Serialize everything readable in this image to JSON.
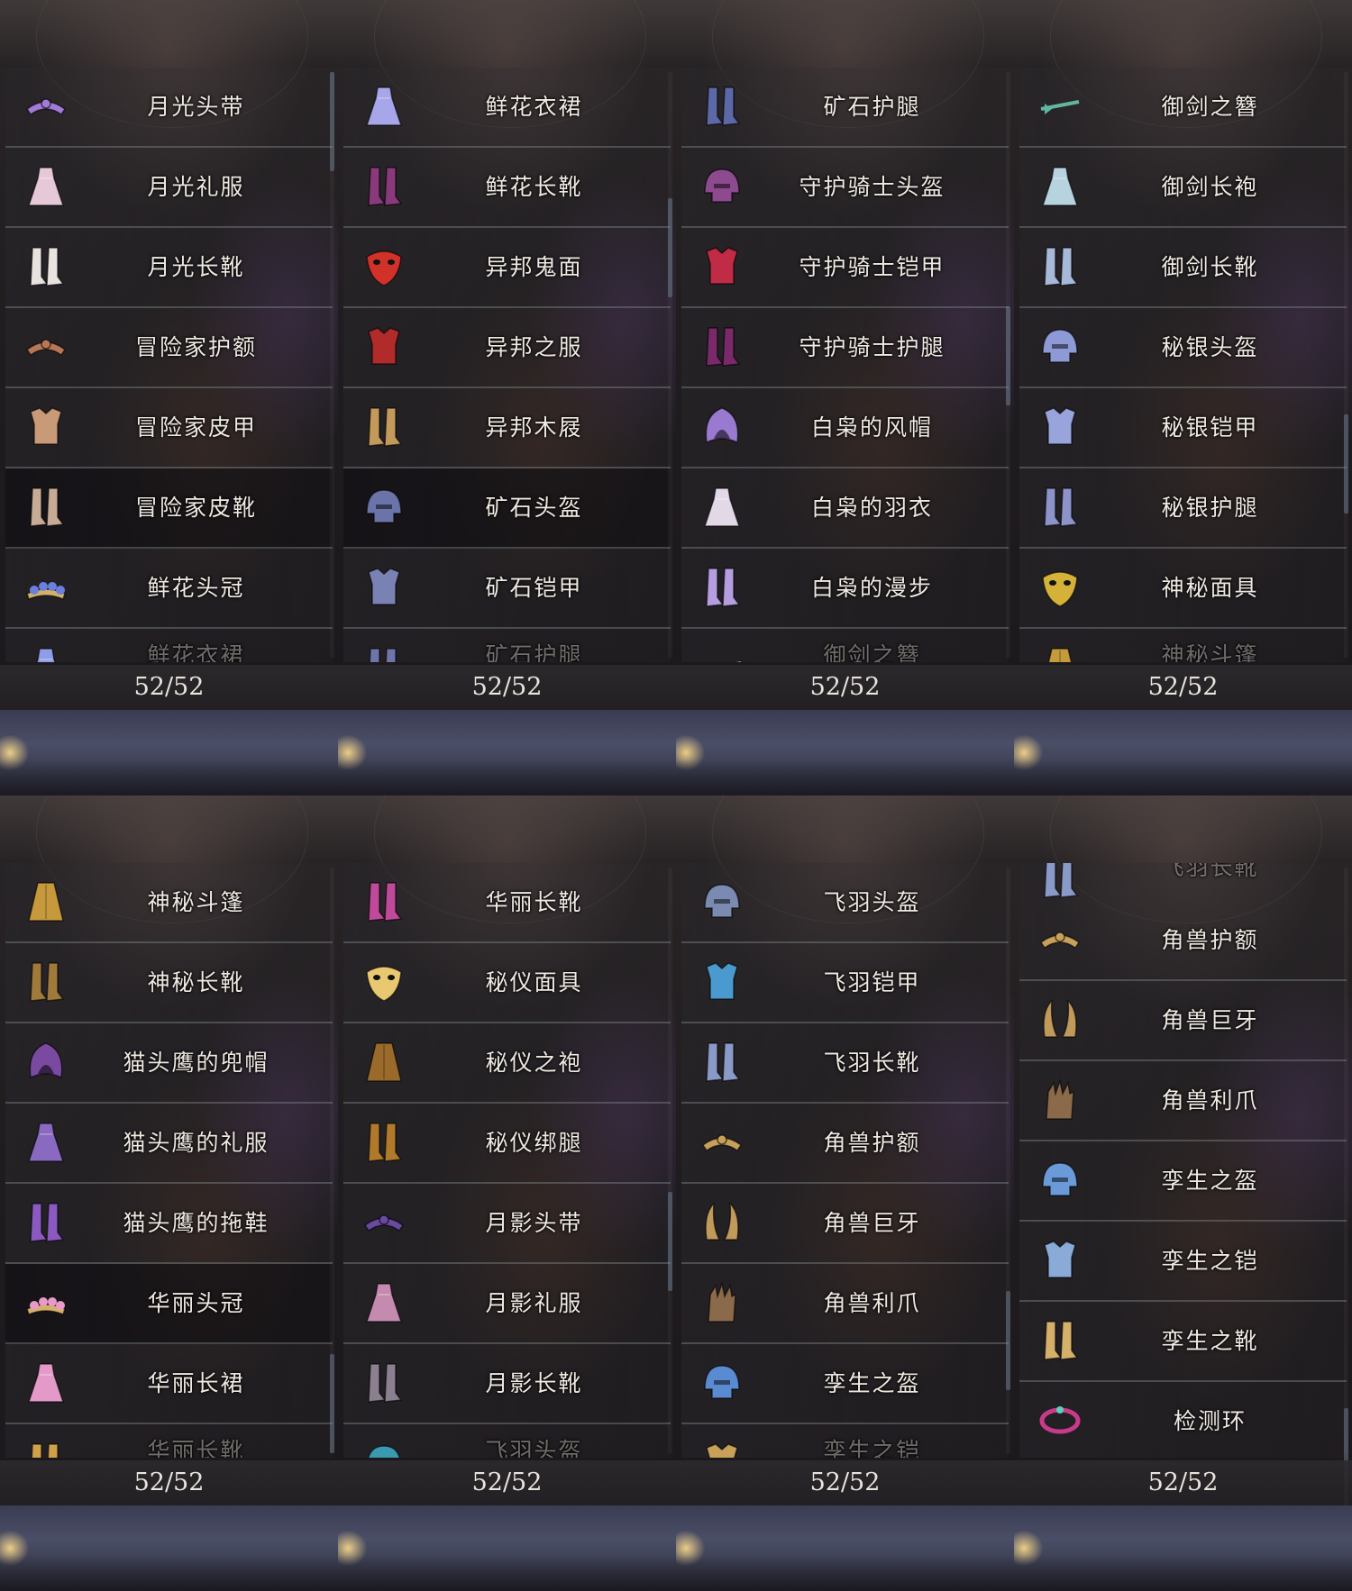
{
  "panels": [
    {
      "count": "52/52",
      "items": [
        {
          "name": "月光头带",
          "icon": "headband-icon",
          "color": "#a27bd6"
        },
        {
          "name": "月光礼服",
          "icon": "dress-icon",
          "color": "#e6c9d8"
        },
        {
          "name": "月光长靴",
          "icon": "boots-icon",
          "color": "#e9e3e0"
        },
        {
          "name": "冒险家护额",
          "icon": "headband-icon",
          "color": "#b87858"
        },
        {
          "name": "冒险家皮甲",
          "icon": "armor-icon",
          "color": "#c99a77"
        },
        {
          "name": "冒险家皮靴",
          "icon": "boots-icon",
          "color": "#c7ab95"
        },
        {
          "name": "鲜花头冠",
          "icon": "crown-icon",
          "color": "#6b7fe0"
        },
        {
          "name": "鲜花衣裙",
          "icon": "dress-icon",
          "color": "#8f9ce6",
          "partial": true
        }
      ]
    },
    {
      "count": "52/52",
      "items": [
        {
          "name": "鲜花衣裙",
          "icon": "dress-icon",
          "color": "#a7a6e8"
        },
        {
          "name": "鲜花长靴",
          "icon": "boots-icon",
          "color": "#8a3a7a"
        },
        {
          "name": "异邦鬼面",
          "icon": "mask-icon",
          "color": "#d0322a"
        },
        {
          "name": "异邦之服",
          "icon": "armor-icon",
          "color": "#b22b2b"
        },
        {
          "name": "异邦木屐",
          "icon": "boots-icon",
          "color": "#c49a5a"
        },
        {
          "name": "矿石头盔",
          "icon": "helmet-icon",
          "color": "#6a74a8"
        },
        {
          "name": "矿石铠甲",
          "icon": "armor-icon",
          "color": "#7a82b4"
        },
        {
          "name": "矿石护腿",
          "icon": "boots-icon",
          "color": "#6d76aa",
          "partial": true
        }
      ]
    },
    {
      "count": "52/52",
      "items": [
        {
          "name": "矿石护腿",
          "icon": "boots-icon",
          "color": "#5d68a6"
        },
        {
          "name": "守护骑士头盔",
          "icon": "helmet-icon",
          "color": "#8d4a8f"
        },
        {
          "name": "守护骑士铠甲",
          "icon": "armor-icon",
          "color": "#c02b45"
        },
        {
          "name": "守护骑士护腿",
          "icon": "boots-icon",
          "color": "#7a2a6a"
        },
        {
          "name": "白枭的风帽",
          "icon": "hood-icon",
          "color": "#9a7ad0"
        },
        {
          "name": "白枭的羽衣",
          "icon": "dress-icon",
          "color": "#e2d8e6"
        },
        {
          "name": "白枭的漫步",
          "icon": "boots-icon",
          "color": "#b59ee0"
        },
        {
          "name": "御剑之簪",
          "icon": "hairpin-icon",
          "color": "#9aa6c0",
          "partial": true
        }
      ]
    },
    {
      "count": "52/52",
      "items": [
        {
          "name": "御剑之簪",
          "icon": "hairpin-icon",
          "color": "#5fb7a0"
        },
        {
          "name": "御剑长袍",
          "icon": "dress-icon",
          "color": "#b7d3e0"
        },
        {
          "name": "御剑长靴",
          "icon": "boots-icon",
          "color": "#a7b8d8"
        },
        {
          "name": "秘银头盔",
          "icon": "helmet-icon",
          "color": "#8e9ad6"
        },
        {
          "name": "秘银铠甲",
          "icon": "armor-icon",
          "color": "#9aa4dc"
        },
        {
          "name": "秘银护腿",
          "icon": "boots-icon",
          "color": "#8b93c8"
        },
        {
          "name": "神秘面具",
          "icon": "mask-icon",
          "color": "#d4b23a"
        },
        {
          "name": "神秘斗篷",
          "icon": "cloak-icon",
          "color": "#c49a3a",
          "partial": true
        }
      ]
    },
    {
      "count": "52/52",
      "items": [
        {
          "name": "神秘斗篷",
          "icon": "cloak-icon",
          "color": "#c69a3c"
        },
        {
          "name": "神秘长靴",
          "icon": "boots-icon",
          "color": "#a07a3a"
        },
        {
          "name": "猫头鹰的兜帽",
          "icon": "hood-icon",
          "color": "#7a4aa0"
        },
        {
          "name": "猫头鹰的礼服",
          "icon": "dress-icon",
          "color": "#8a6ac0"
        },
        {
          "name": "猫头鹰的拖鞋",
          "icon": "boots-icon",
          "color": "#8a5ac0"
        },
        {
          "name": "华丽头冠",
          "icon": "crown-icon",
          "color": "#ea9ac8"
        },
        {
          "name": "华丽长裙",
          "icon": "dress-icon",
          "color": "#e49ac8"
        },
        {
          "name": "华丽长靴",
          "icon": "boots-icon",
          "color": "#d0a04a",
          "partial": true
        }
      ]
    },
    {
      "count": "52/52",
      "items": [
        {
          "name": "华丽长靴",
          "icon": "boots-icon",
          "color": "#c04a9a"
        },
        {
          "name": "秘仪面具",
          "icon": "mask-icon",
          "color": "#e8c870"
        },
        {
          "name": "秘仪之袍",
          "icon": "cloak-icon",
          "color": "#9a6a2a"
        },
        {
          "name": "秘仪绑腿",
          "icon": "boots-icon",
          "color": "#b07a2a"
        },
        {
          "name": "月影头带",
          "icon": "headband-icon",
          "color": "#6a4aa0"
        },
        {
          "name": "月影礼服",
          "icon": "dress-icon",
          "color": "#c48ab0"
        },
        {
          "name": "月影长靴",
          "icon": "boots-icon",
          "color": "#8a8090"
        },
        {
          "name": "飞羽头盔",
          "icon": "helmet-icon",
          "color": "#3a9ab0",
          "partial": true
        }
      ]
    },
    {
      "count": "52/52",
      "items": [
        {
          "name": "飞羽头盔",
          "icon": "helmet-icon",
          "color": "#7a8ab0"
        },
        {
          "name": "飞羽铠甲",
          "icon": "armor-icon",
          "color": "#4a9ad0"
        },
        {
          "name": "飞羽长靴",
          "icon": "boots-icon",
          "color": "#8a9ac8"
        },
        {
          "name": "角兽护额",
          "icon": "headband-icon",
          "color": "#c8a05a"
        },
        {
          "name": "角兽巨牙",
          "icon": "horn-icon",
          "color": "#c09a5a"
        },
        {
          "name": "角兽利爪",
          "icon": "claw-icon",
          "color": "#8a6a4a"
        },
        {
          "name": "孪生之盔",
          "icon": "helmet-icon",
          "color": "#5a8ad0"
        },
        {
          "name": "孪生之铠",
          "icon": "armor-icon",
          "color": "#c8a05a",
          "partial": true
        }
      ]
    },
    {
      "count": "52/52",
      "items": [
        {
          "name": "飞羽长靴",
          "icon": "boots-icon",
          "color": "#8a9ac8",
          "partial_top": true
        },
        {
          "name": "角兽护额",
          "icon": "headband-icon",
          "color": "#c8a05a"
        },
        {
          "name": "角兽巨牙",
          "icon": "horn-icon",
          "color": "#c09a5a"
        },
        {
          "name": "角兽利爪",
          "icon": "claw-icon",
          "color": "#8a6a4a"
        },
        {
          "name": "孪生之盔",
          "icon": "helmet-icon",
          "color": "#6a9ad8"
        },
        {
          "name": "孪生之铠",
          "icon": "armor-icon",
          "color": "#8aaad8"
        },
        {
          "name": "孪生之靴",
          "icon": "boots-icon",
          "color": "#d4b06a"
        },
        {
          "name": "检测环",
          "icon": "ring-icon",
          "color": "#c83a8a"
        }
      ]
    }
  ]
}
